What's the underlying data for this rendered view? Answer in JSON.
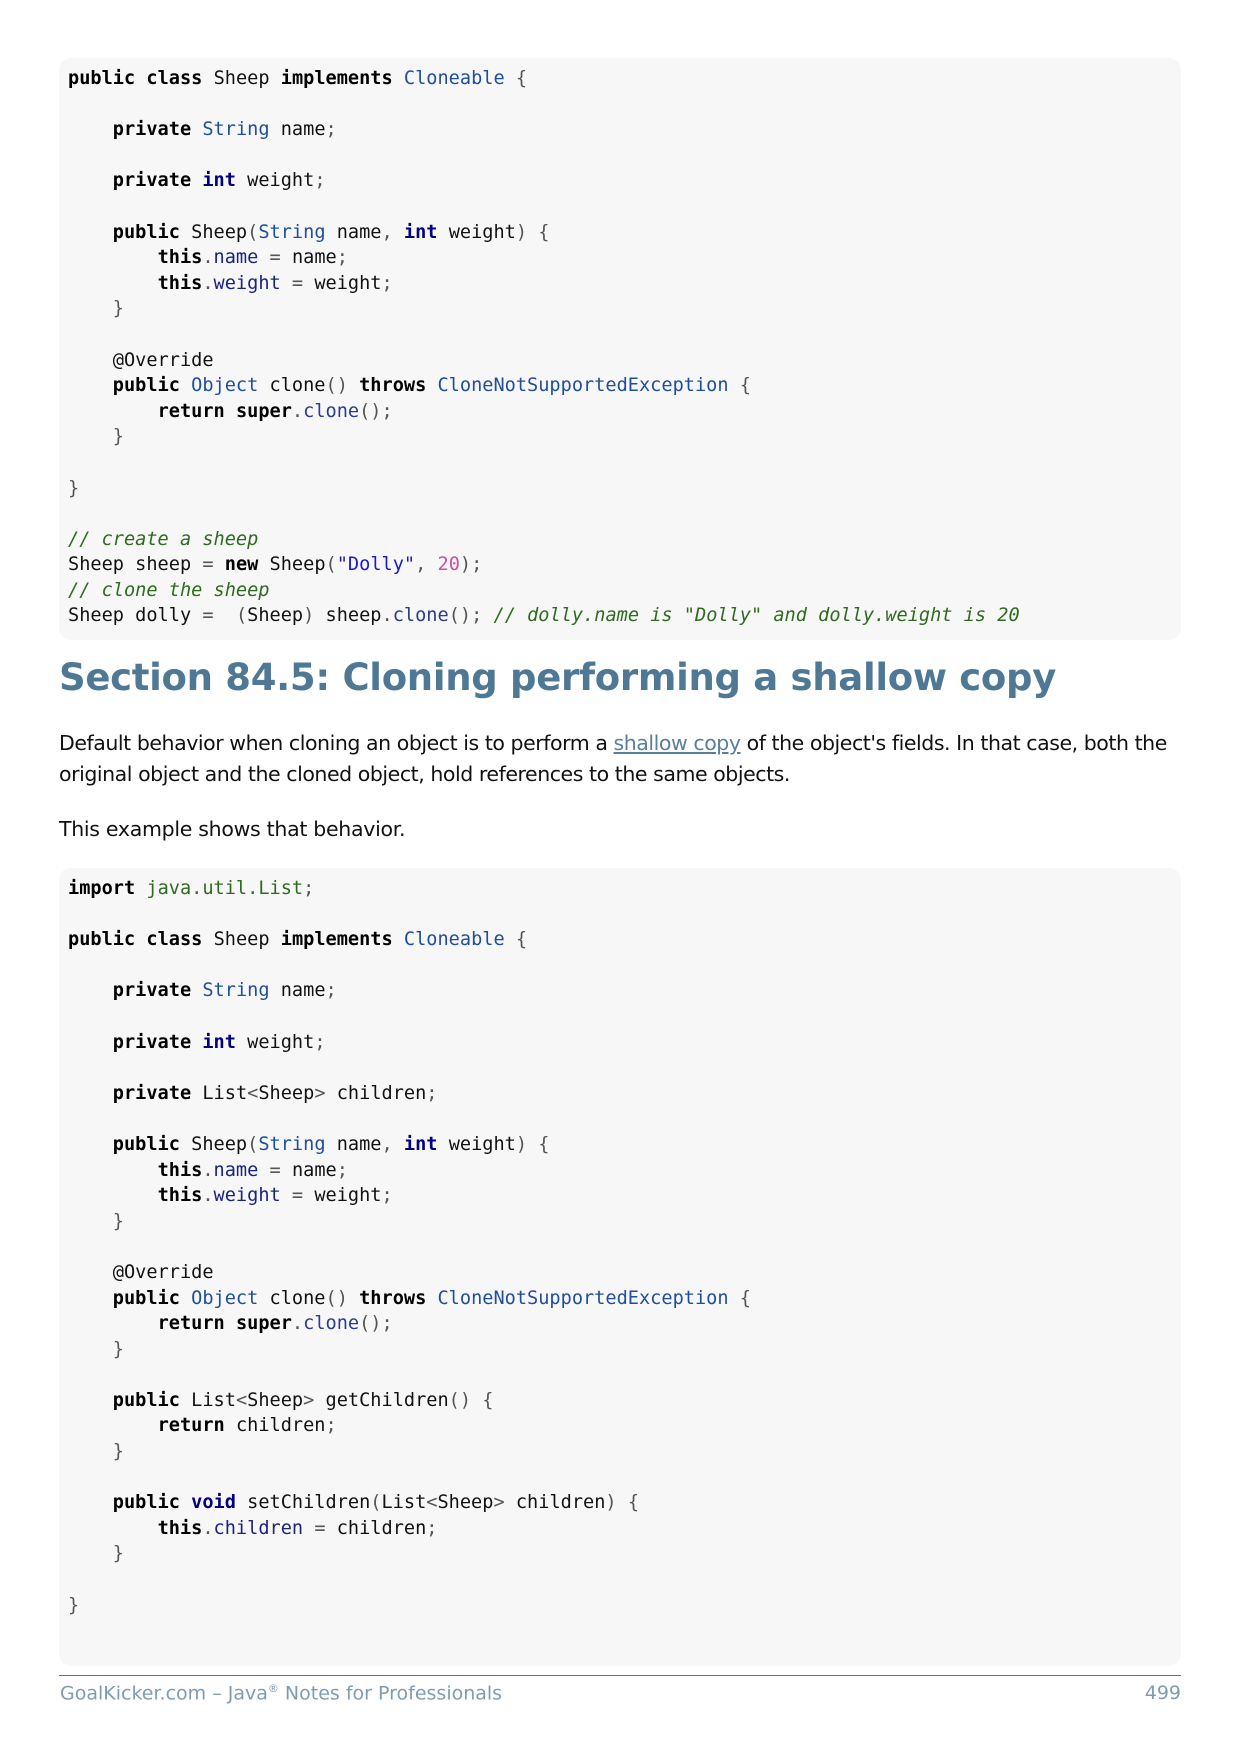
{
  "code_block_1": {
    "l01": [
      "public",
      "class",
      "Sheep",
      "implements",
      "Cloneable",
      "{"
    ],
    "l03": [
      "private",
      "String",
      "name",
      ";"
    ],
    "l05": [
      "private",
      "int",
      "weight",
      ";"
    ],
    "l07": [
      "public",
      "Sheep",
      "(",
      "String",
      "name",
      ",",
      "int",
      "weight",
      ")",
      "{"
    ],
    "l08": [
      "this",
      ".",
      "name",
      "=",
      "name",
      ";"
    ],
    "l09": [
      "this",
      ".",
      "weight",
      "=",
      "weight",
      ";"
    ],
    "l10": [
      "}"
    ],
    "l12": [
      "@Override"
    ],
    "l13": [
      "public",
      "Object",
      "clone",
      "()",
      "throws",
      "CloneNotSupportedException",
      "{"
    ],
    "l14": [
      "return",
      "super",
      ".",
      "clone",
      "();"
    ],
    "l15": [
      "}"
    ],
    "l17": [
      "}"
    ],
    "l19": [
      "// create a sheep"
    ],
    "l20": [
      "Sheep sheep ",
      "=",
      "new",
      "Sheep",
      "(",
      "\"Dolly\"",
      ",",
      "20",
      ");"
    ],
    "l21": [
      "// clone the sheep"
    ],
    "l22": [
      "Sheep dolly ",
      "=",
      "(",
      "Sheep",
      ")",
      "sheep",
      ".",
      "clone",
      "();",
      "// dolly.name is \"Dolly\" and dolly.weight is 20"
    ]
  },
  "section": {
    "heading": "Section 84.5: Cloning performing a shallow copy",
    "para1_before": "Default behavior when cloning an object is to perform a ",
    "para1_link": "shallow copy",
    "para1_after": " of the object's fields. In that case, both the original object and the cloned object, hold references to the same objects.",
    "para2": "This example shows that behavior."
  },
  "code_block_2": {
    "l01": [
      "import",
      "java.util.List",
      ";"
    ],
    "l03": [
      "public",
      "class",
      "Sheep",
      "implements",
      "Cloneable",
      "{"
    ],
    "l05": [
      "private",
      "String",
      "name",
      ";"
    ],
    "l07": [
      "private",
      "int",
      "weight",
      ";"
    ],
    "l09": [
      "private",
      "List",
      "<",
      "Sheep",
      ">",
      "children",
      ";"
    ],
    "l11": [
      "public",
      "Sheep",
      "(",
      "String",
      "name",
      ",",
      "int",
      "weight",
      ")",
      "{"
    ],
    "l12": [
      "this",
      ".",
      "name",
      "=",
      "name",
      ";"
    ],
    "l13": [
      "this",
      ".",
      "weight",
      "=",
      "weight",
      ";"
    ],
    "l14": [
      "}"
    ],
    "l16": [
      "@Override"
    ],
    "l17": [
      "public",
      "Object",
      "clone",
      "()",
      "throws",
      "CloneNotSupportedException",
      "{"
    ],
    "l18": [
      "return",
      "super",
      ".",
      "clone",
      "();"
    ],
    "l19": [
      "}"
    ],
    "l21": [
      "public",
      "List",
      "<",
      "Sheep",
      ">",
      "getChildren",
      "()",
      "{"
    ],
    "l22": [
      "return",
      "children",
      ";"
    ],
    "l23": [
      "}"
    ],
    "l25": [
      "public",
      "void",
      "setChildren",
      "(",
      "List",
      "<",
      "Sheep",
      ">",
      "children",
      ")",
      "{"
    ],
    "l26": [
      "this",
      ".",
      "children",
      "=",
      "children",
      ";"
    ],
    "l27": [
      "}"
    ],
    "l29": [
      "}"
    ]
  },
  "footer": {
    "title_pre": "GoalKicker.com – Java",
    "title_reg": "®",
    "title_post": " Notes for Professionals",
    "page": "499"
  },
  "colors": {
    "heading": "#4f7895",
    "code_background": "#f7f7f7",
    "comment": "#2e6b1f",
    "string": "#1a1acc",
    "number": "#c8559f",
    "type": "#1f4e9a",
    "primitive_keyword": "#000080",
    "footer": "#7d9cb3"
  }
}
